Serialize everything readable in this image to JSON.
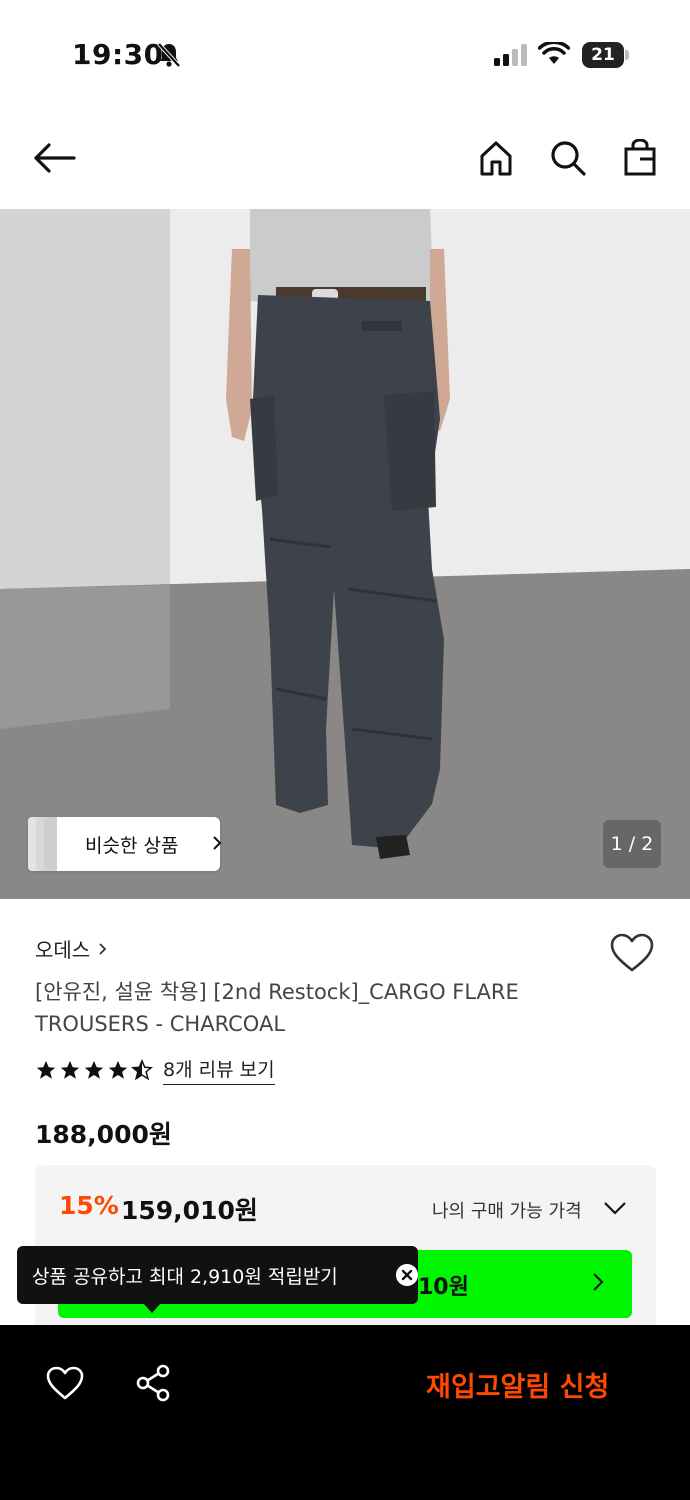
{
  "status_bar": {
    "time": "19:30",
    "battery_level": "21"
  },
  "nav": {
    "back_icon": "arrow-left-icon",
    "home_icon": "home-icon",
    "search_icon": "search-icon",
    "bag_icon": "shopping-bag-icon"
  },
  "hero": {
    "similar_products_label": "비슷한 상품",
    "page_counter": "1 / 2"
  },
  "product": {
    "brand": "오데스",
    "title": "[안유진, 설윤 착용] [2nd Restock]_CARGO FLARE TROUSERS - CHARCOAL",
    "rating": 4.5,
    "rating_max": 5,
    "review_link": "8개 리뷰 보기",
    "original_price": "188,000원",
    "discount_rate": "15%",
    "discount_price": "159,010원",
    "my_price_label": "나의 구매 가능 가격",
    "coupon_price_partial": "10원"
  },
  "tooltip": {
    "text": "상품 공유하고 최대 2,910원 적립받기"
  },
  "bottom_bar": {
    "restock_button": "재입고알림 신청"
  },
  "colors": {
    "accent_orange": "#ff4800",
    "coupon_green": "#00f500",
    "bottom_bar_bg": "#000000"
  }
}
